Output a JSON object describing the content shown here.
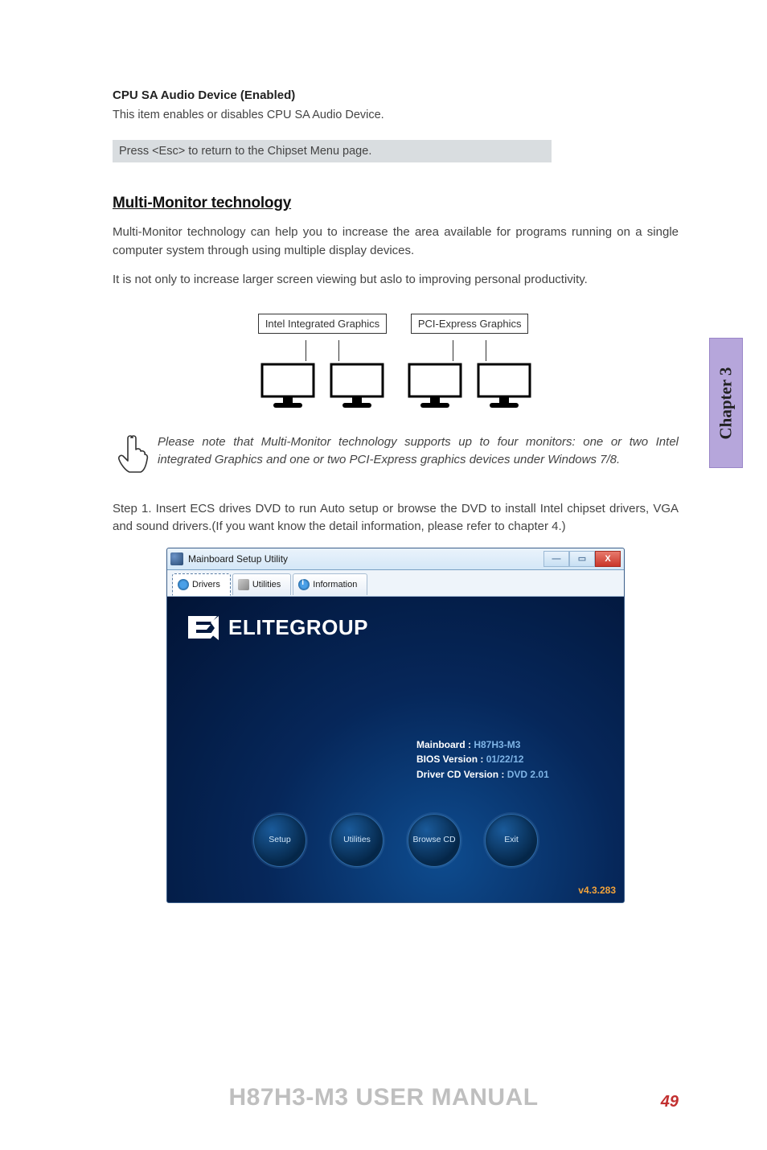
{
  "heading1": "CPU SA Audio Device (Enabled)",
  "heading1_desc": "This item enables or disables CPU SA Audio Device.",
  "esc_hint": "Press <Esc> to return to the Chipset Menu page.",
  "section_title": "Multi-Monitor technology",
  "para1": "Multi-Monitor technology can help you to increase the area available for programs running on a single computer system through using multiple display devices.",
  "para2": "It is not only to increase larger screen viewing but aslo to improving personal productivity.",
  "diagram": {
    "left_label": "Intel Integrated Graphics",
    "right_label": "PCI-Express Graphics"
  },
  "note": "Please note that Multi-Monitor technology supports up to four monitors: one or two Intel integrated Graphics and one or two PCI-Express graphics devices under Windows 7/8.",
  "step1": "Step 1. Insert ECS drives DVD to run Auto setup or browse the DVD to install Intel chipset drivers, VGA and sound drivers.(If you want know the detail information, please refer to chapter 4.)",
  "chapter_tab": "Chapter 3",
  "utility": {
    "title": "Mainboard Setup Utility",
    "tabs": {
      "drivers": "Drivers",
      "utilities": "Utilities",
      "information": "Information"
    },
    "brand": "ELITEGROUP",
    "info": {
      "mainboard_label": "Mainboard : ",
      "mainboard_value": "H87H3-M3",
      "bios_label": "BIOS Version : ",
      "bios_value": "01/22/12",
      "cd_label": "Driver CD Version : ",
      "cd_value": "DVD 2.01"
    },
    "buttons": {
      "setup": "Setup",
      "utilities": "Utilities",
      "browse": "Browse CD",
      "exit": "Exit"
    },
    "version": "v4.3.283",
    "win": {
      "min": "—",
      "max": "▭",
      "close": "X"
    }
  },
  "footer_title": "H87H3-M3 USER MANUAL",
  "page_number": "49"
}
